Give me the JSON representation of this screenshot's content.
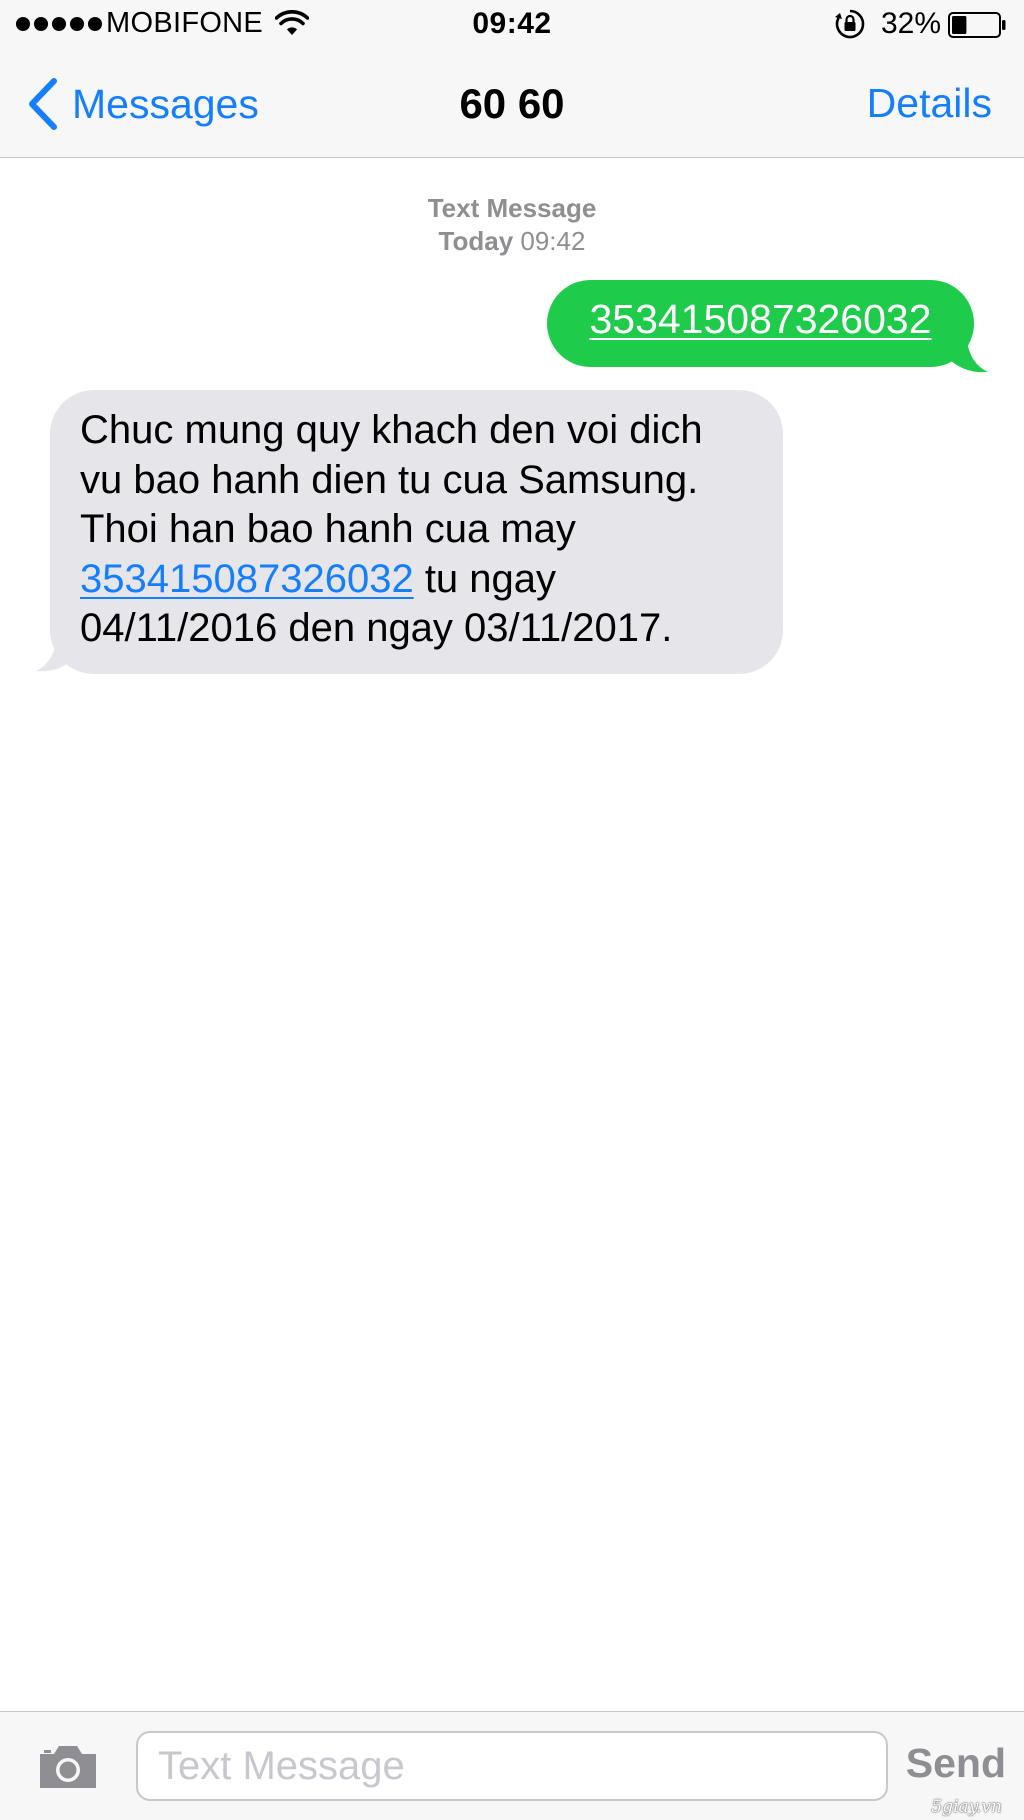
{
  "status_bar": {
    "carrier": "MOBIFONE",
    "time": "09:42",
    "battery_percent": "32%",
    "battery_level": 0.32
  },
  "nav": {
    "back_label": "Messages",
    "title": "60 60",
    "details_label": "Details"
  },
  "conversation": {
    "header_type": "Text Message",
    "header_day": "Today",
    "header_time": "09:42",
    "sent_message": "353415087326032",
    "received_message": {
      "text_before": "Chuc mung quy khach den voi dich vu bao hanh dien tu cua Samsung. Thoi han bao hanh cua may ",
      "link": "353415087326032",
      "text_after": " tu ngay 04/11/2016 den ngay 03/11/2017."
    }
  },
  "input_bar": {
    "placeholder": "Text Message",
    "send_label": "Send"
  },
  "watermark": "5giay.vn",
  "colors": {
    "ios_blue": "#157efb",
    "sms_green": "#1fcb4a",
    "received_bubble": "#e5e5ea",
    "bar_background": "#f7f7f7",
    "secondary_gray": "#8e8e93"
  },
  "icons": {
    "back": "chevron-left-icon",
    "wifi": "wifi-icon",
    "rotation_lock": "rotation-lock-icon",
    "battery": "battery-icon",
    "camera": "camera-icon"
  }
}
